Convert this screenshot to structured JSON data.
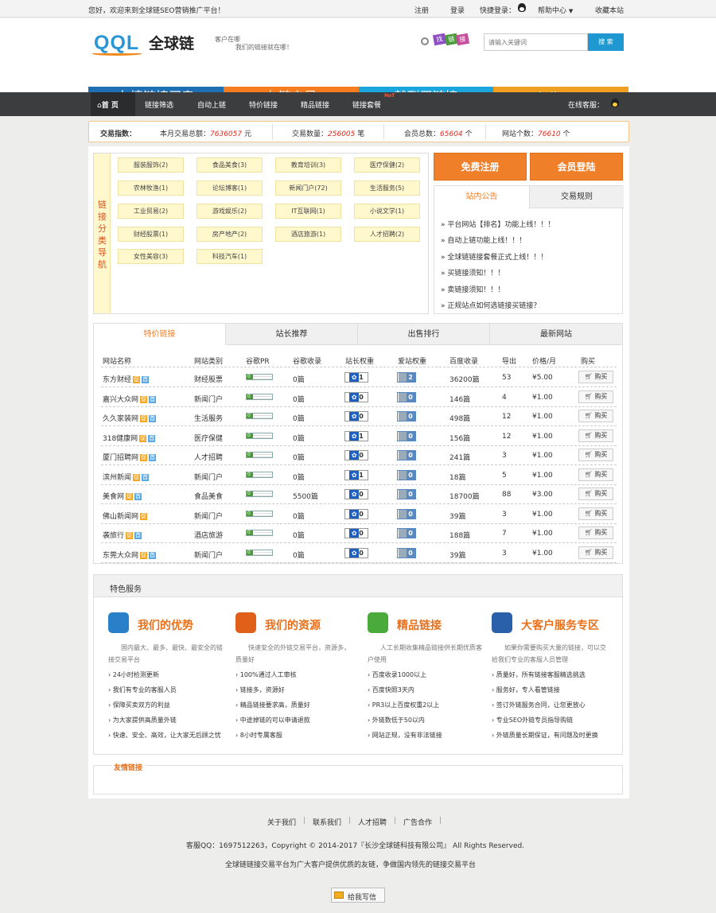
{
  "topbar": {
    "welcome": "您好，欢迎来到全球链SEO营销推广平台！",
    "register": "注册",
    "login": "登录",
    "quick_login": "快捷登录：",
    "help": "帮助中心",
    "favorite": "收藏本站"
  },
  "header": {
    "logo_text": "QQL",
    "logo_cn": "全球链",
    "slogan1": "客户在哪",
    "slogan2": "我们的链接就在哪！",
    "search_tags": [
      "找",
      "链",
      "接"
    ],
    "search_placeholder": "请输入关键词",
    "search_button": "搜 索"
  },
  "banners": [
    {
      "text": "友情链接买卖",
      "color": "#1f6fb5"
    },
    {
      "text": "友链交易",
      "color": "#f57c1f"
    },
    {
      "text": "就到买链接",
      "color": "#1aa6dc"
    },
    {
      "text": "quanqiulian.com.cn",
      "color": "#f0a020"
    }
  ],
  "nav": {
    "items": [
      "首 页",
      "链接筛选",
      "自动上链",
      "特价链接",
      "精品链接",
      "链接套餐"
    ],
    "hot_badge": "HoT",
    "online_service": "在线客服："
  },
  "stats": {
    "label": "交易指数：",
    "month_total_label": "本月交易总额：",
    "month_total": "7636057",
    "month_total_unit": "元",
    "trade_count_label": "交易数量：",
    "trade_count": "256005",
    "trade_count_unit": "笔",
    "members_label": "会员总数：",
    "members": "65604",
    "members_unit": "个",
    "sites_label": "网站个数：",
    "sites": "76610",
    "sites_unit": "个"
  },
  "categories": {
    "label": "链接分类导航",
    "items": [
      "服装服饰(2)",
      "食品美食(3)",
      "教育培训(3)",
      "医疗保健(2)",
      "农林牧渔(1)",
      "论坛博客(1)",
      "新闻门户(72)",
      "生活服务(5)",
      "工业贸易(2)",
      "游戏娱乐(2)",
      "IT互联网(1)",
      "小说文学(1)",
      "财经股票(1)",
      "房产地产(2)",
      "酒店旅游(1)",
      "人才招聘(2)",
      "女性美容(3)",
      "科技汽车(1)"
    ]
  },
  "actions": {
    "register": "免费注册",
    "member_login": "会员登陆"
  },
  "notice": {
    "tabs": [
      "站内公告",
      "交易规则"
    ],
    "items": [
      "» 平台网站【排名】功能上线！！！",
      "» 自动上链功能上线！！！",
      "» 全球链链接套餐正式上线！！！",
      "» 买链接须知！！！",
      "» 卖链接须知！！！",
      "» 正规站点如何选链接买链接？"
    ]
  },
  "market": {
    "tabs": [
      "特价链接",
      "站长推荐",
      "出售排行",
      "最新网站"
    ],
    "columns": [
      "网站名称",
      "网站类别",
      "谷歌PR",
      "谷歌收录",
      "站长权重",
      "爱站权重",
      "百度收录",
      "导出",
      "价格/月",
      "购买"
    ],
    "buy_label": "购买",
    "rows": [
      {
        "name": "东方财经",
        "badges": [
          "促",
          "首"
        ],
        "category": "财经股票",
        "pr": "0",
        "google": "0篇",
        "zz": "1",
        "az": "2",
        "baidu": "36200篇",
        "out": "53",
        "price": "¥5.00"
      },
      {
        "name": "嘉兴大众网",
        "badges": [
          "促",
          "首"
        ],
        "category": "新闻门户",
        "pr": "0",
        "google": "0篇",
        "zz": "0",
        "az": "0",
        "baidu": "146篇",
        "out": "4",
        "price": "¥1.00"
      },
      {
        "name": "久久家装网",
        "badges": [
          "促",
          "首"
        ],
        "category": "生活服务",
        "pr": "0",
        "google": "0篇",
        "zz": "0",
        "az": "0",
        "baidu": "498篇",
        "out": "12",
        "price": "¥1.00"
      },
      {
        "name": "318健康网",
        "badges": [
          "促",
          "首"
        ],
        "category": "医疗保健",
        "pr": "0",
        "google": "0篇",
        "zz": "1",
        "az": "0",
        "baidu": "156篇",
        "out": "12",
        "price": "¥1.00"
      },
      {
        "name": "厦门招聘网",
        "badges": [
          "促",
          "首"
        ],
        "category": "人才招聘",
        "pr": "0",
        "google": "0篇",
        "zz": "0",
        "az": "0",
        "baidu": "241篇",
        "out": "3",
        "price": "¥1.00"
      },
      {
        "name": "滨州新闻",
        "badges": [
          "促",
          "首"
        ],
        "category": "新闻门户",
        "pr": "0",
        "google": "0篇",
        "zz": "1",
        "az": "0",
        "baidu": "18篇",
        "out": "5",
        "price": "¥1.00"
      },
      {
        "name": "美食网",
        "badges": [
          "促",
          "首"
        ],
        "category": "食品美食",
        "pr": "0",
        "google": "5500篇",
        "zz": "0",
        "az": "0",
        "baidu": "18700篇",
        "out": "88",
        "price": "¥3.00"
      },
      {
        "name": "佛山新闻网",
        "badges": [
          "促"
        ],
        "category": "新闻门户",
        "pr": "0",
        "google": "0篇",
        "zz": "0",
        "az": "0",
        "baidu": "39篇",
        "out": "3",
        "price": "¥1.00"
      },
      {
        "name": "袭旅行",
        "badges": [
          "促",
          "首"
        ],
        "category": "酒店旅游",
        "pr": "0",
        "google": "0篇",
        "zz": "0",
        "az": "0",
        "baidu": "188篇",
        "out": "7",
        "price": "¥1.00"
      },
      {
        "name": "东莞大众网",
        "badges": [
          "促",
          "首"
        ],
        "category": "新闻门户",
        "pr": "0",
        "google": "0篇",
        "zz": "0",
        "az": "0",
        "baidu": "39篇",
        "out": "3",
        "price": "¥1.00"
      }
    ]
  },
  "services": {
    "title": "特色服务",
    "blocks": [
      {
        "title": "我们的优势",
        "icon": "user-icon",
        "color": "#2a7fc9",
        "desc": "国内最大、最多、最快、最安全的链接交易平台",
        "points": [
          "› 24小时检测更新",
          "› 我们有专业的客服人员",
          "› 保障买卖双方的利益",
          "› 为大家提供高质量外链",
          "› 快速、安全、高效，让大家无后顾之忧"
        ]
      },
      {
        "title": "我们的资源",
        "icon": "books-icon",
        "color": "#e0601a",
        "desc": "快速安全的外链交易平台，资源多，质量好",
        "points": [
          "› 100%通过人工审核",
          "› 链接多，资源好",
          "› 精品链接要求高，质量好",
          "› 中途掉链的可以申请退款",
          "› 8小时专属客服"
        ]
      },
      {
        "title": "精品链接",
        "icon": "check-icon",
        "color": "#4aaa3a",
        "desc": "人工长期收集精品链接供长期优质客户使用",
        "points": [
          "› 百度收录1000以上",
          "› 百度快照3天内",
          "› PR3以上百度权重2以上",
          "› 外链数低于50以内",
          "› 网站正规，没有非法链接"
        ]
      },
      {
        "title": "大客户服务专区",
        "icon": "globe-icon",
        "color": "#2a5fa9",
        "desc": "如果你需要购买大量的链接，可以交给我们专业的客服人员管理",
        "points": [
          "› 质量好，所有链接客服精选挑选",
          "› 服务好，专人看管链接",
          "› 签订外链服务合同，让您更放心",
          "› 专业SEO外链专员指导购链",
          "› 外链质量长期保证，有问题及时更换"
        ]
      }
    ]
  },
  "friend_links": {
    "title": "友情链接"
  },
  "footer": {
    "links": [
      "关于我们",
      "联系我们",
      "人才招聘",
      "广告合作"
    ],
    "copyright": "客服QQ：1697512263，Copyright © 2014-2017『长沙全球链科技有限公司』 All Rights Reserved.",
    "tagline": "全球链链接交易平台为广大客户提供优质的友链，争做国内领先的链接交易平台",
    "mail_button": "给我写信"
  }
}
